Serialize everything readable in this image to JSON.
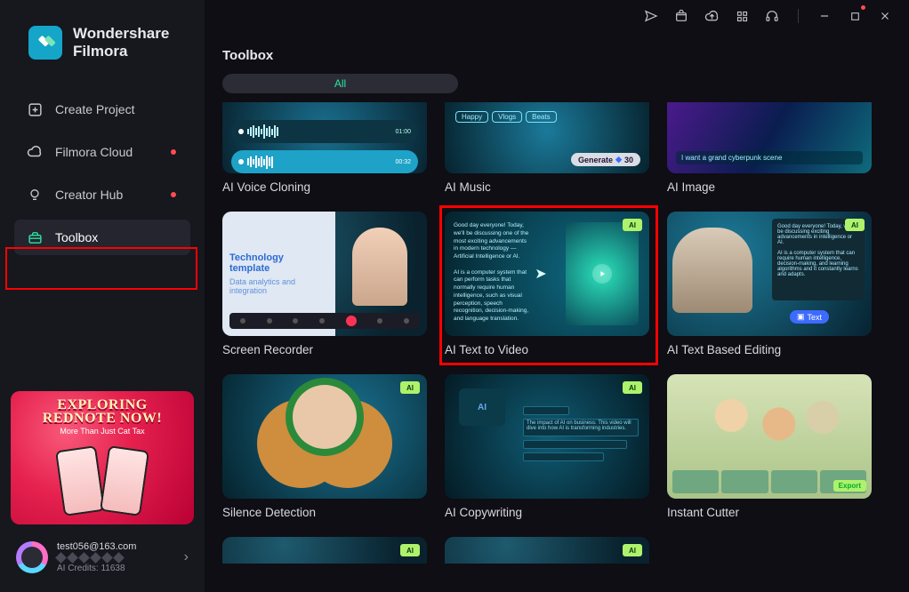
{
  "app": {
    "brand_line1": "Wondershare",
    "brand_line2": "Filmora"
  },
  "sidebar": {
    "items": [
      {
        "label": "Create Project",
        "icon": "plus-square",
        "badge": false
      },
      {
        "label": "Filmora Cloud",
        "icon": "cloud",
        "badge": true
      },
      {
        "label": "Creator Hub",
        "icon": "bulb",
        "badge": true
      },
      {
        "label": "Toolbox",
        "icon": "toolbox",
        "badge": false,
        "active": true
      }
    ]
  },
  "promo": {
    "line1": "EXPLORING",
    "line2": "REDNOTE NOW!",
    "sub": "More Than Just Cat Tax"
  },
  "user": {
    "name": "test056@163.com",
    "credits": "AI Credits: 11638"
  },
  "page": {
    "title": "Toolbox",
    "filter": "All"
  },
  "toolbox": {
    "row1": [
      {
        "title": "AI Voice Cloning",
        "ai": false,
        "kind": "voice_clone"
      },
      {
        "title": "AI Music",
        "ai": false,
        "kind": "music"
      },
      {
        "title": "AI Image",
        "ai": false,
        "kind": "image"
      }
    ],
    "row2": [
      {
        "title": "Screen Recorder",
        "ai": false,
        "kind": "screen"
      },
      {
        "title": "AI Text to Video",
        "ai": true,
        "kind": "ttv",
        "highlight": true
      },
      {
        "title": "AI Text Based Editing",
        "ai": true,
        "kind": "tbe"
      }
    ],
    "row3": [
      {
        "title": "Silence Detection",
        "ai": true,
        "kind": "silence"
      },
      {
        "title": "AI Copywriting",
        "ai": true,
        "kind": "copy"
      },
      {
        "title": "Instant Cutter",
        "ai": false,
        "kind": "cutter"
      }
    ]
  },
  "music_tags": [
    "Happy",
    "Vlogs",
    "Beats"
  ],
  "music_gen": "Generate",
  "music_credits": "30",
  "image_caption": "I want a grand cyberpunk scene",
  "screen": {
    "t1": "Technology",
    "t2": "template"
  },
  "ttv": {
    "p1": "Good day everyone! Today, we'll be discussing one of the most exciting advancements in modern technology — Artificial Intelligence or AI.",
    "p2": "AI is a computer system that can perform tasks that normally require human intelligence, such as visual perception, speech recognition, decision-making, and language translation."
  },
  "tbe_btn": "Text",
  "cutter_btn": "Export",
  "ai_badge": "AI"
}
